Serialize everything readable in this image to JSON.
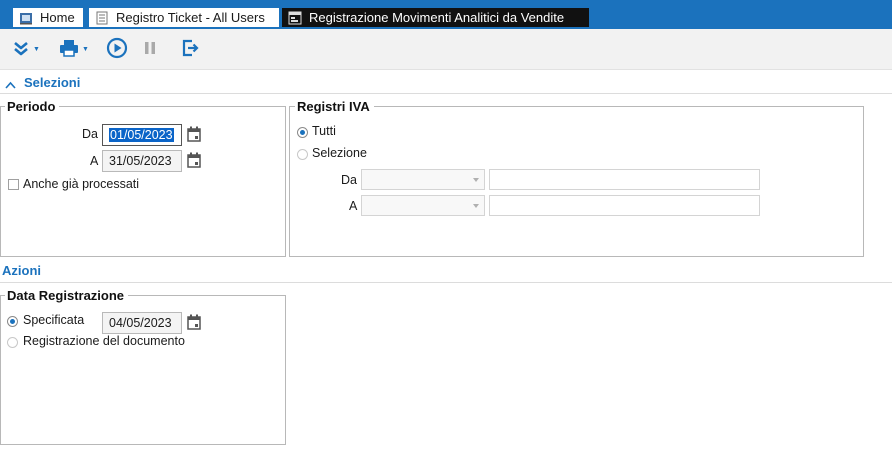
{
  "tabs": {
    "home": "Home",
    "registro": "Registro Ticket - All Users",
    "movimenti": "Registrazione Movimenti Analitici da Vendite"
  },
  "toolbar": {
    "icons": [
      "expand-double-chevron-icon",
      "print-icon",
      "play-icon",
      "pause-icon",
      "exit-icon"
    ]
  },
  "selezioni": {
    "title": "Selezioni",
    "periodo": {
      "legend": "Periodo",
      "da_label": "Da",
      "da_value": "01/05/2023",
      "a_label": "A",
      "a_value": "31/05/2023",
      "anche_label": "Anche già processati"
    },
    "registri": {
      "legend": "Registri IVA",
      "tutti_label": "Tutti",
      "selezione_label": "Selezione",
      "da_label": "Da",
      "a_label": "A"
    }
  },
  "azioni": {
    "title": "Azioni",
    "data_reg": {
      "legend": "Data Registrazione",
      "specificata_label": "Specificata",
      "specificata_value": "04/05/2023",
      "documento_label": "Registrazione del documento"
    }
  },
  "colors": {
    "accent": "#1b72bd",
    "active_tab": "#111111",
    "selection": "#0a64c8"
  }
}
